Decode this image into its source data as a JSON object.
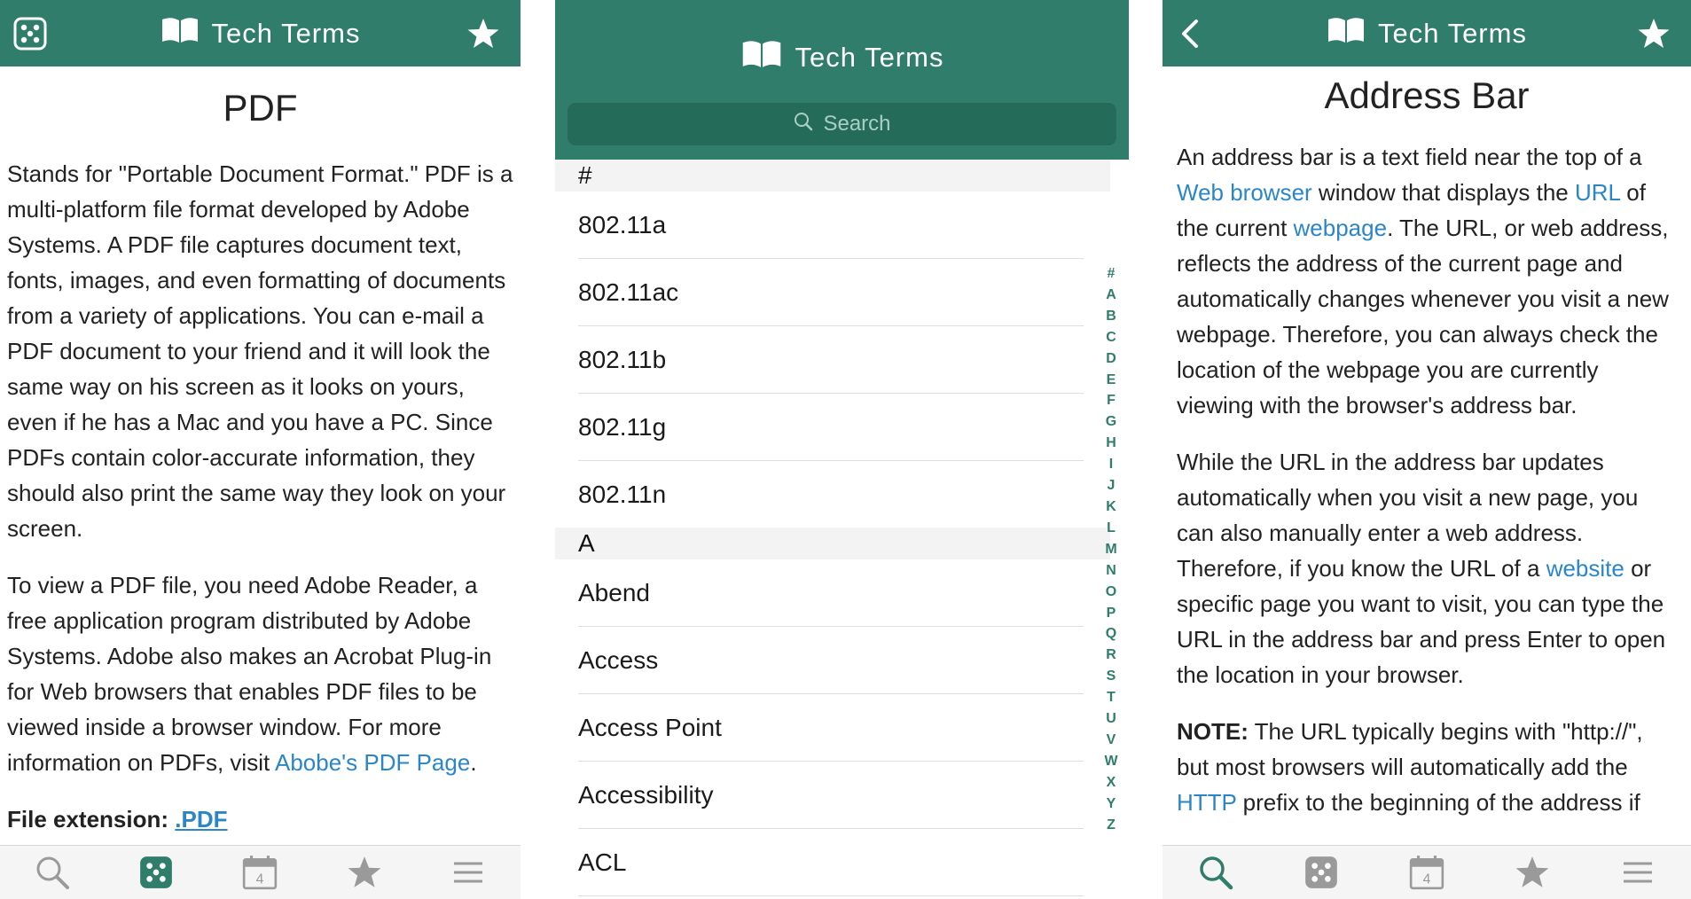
{
  "app_title": "Tech Terms",
  "left": {
    "title": "PDF",
    "paragraph1": "Stands for \"Portable Document Format.\" PDF is a multi-platform file format developed by Adobe Systems. A PDF file captures document text, fonts, images, and even formatting of documents from a variety of applications. You can e-mail a PDF document to your friend and it will look the same way on his screen as it looks on yours, even if he has a Mac and you have a PC. Since PDFs contain color-accurate information, they should also print the same way they look on your screen.",
    "paragraph2_text": "To view a PDF file, you need Adobe Reader, a free application program distributed by Adobe Systems. Adobe also makes an Acrobat Plug-in for Web browsers that enables PDF files to be viewed inside a browser window. For more information on PDFs, visit ",
    "paragraph2_link": "Abobe's PDF Page",
    "paragraph2_end": ".",
    "file_ext_label": "File extension:",
    "file_ext_value": ".PDF"
  },
  "middle": {
    "search_placeholder": "Search",
    "sections": [
      {
        "header": "#",
        "items": [
          "802.11a",
          "802.11ac",
          "802.11b",
          "802.11g",
          "802.11n"
        ]
      },
      {
        "header": "A",
        "items": [
          "Abend",
          "Access",
          "Access Point",
          "Accessibility",
          "ACL"
        ]
      }
    ],
    "index": [
      "#",
      "A",
      "B",
      "C",
      "D",
      "E",
      "F",
      "G",
      "H",
      "I",
      "J",
      "K",
      "L",
      "M",
      "N",
      "O",
      "P",
      "Q",
      "R",
      "S",
      "T",
      "U",
      "V",
      "W",
      "X",
      "Y",
      "Z"
    ]
  },
  "right": {
    "title": "Address Bar",
    "p1_a": "An address bar is a text field near the top of a ",
    "p1_link1": "Web browser",
    "p1_b": " window that displays the ",
    "p1_link2": "URL",
    "p1_c": " of the current ",
    "p1_link3": "webpage",
    "p1_d": ". The URL, or web address, reflects the address of the current page and automatically changes whenever you visit a new webpage. Therefore, you can always check the location of the webpage you are currently viewing with the browser's address bar.",
    "p2_a": "While the URL in the address bar updates automatically when you visit a new page, you can also manually enter a web address. Therefore, if you know the URL of a ",
    "p2_link": "website",
    "p2_b": " or specific page you want to visit, you can type the URL in the address bar and press Enter to open the location in your browser.",
    "p3_label": "NOTE:",
    "p3_a": " The URL typically begins with \"http://\", but most browsers will automatically add the ",
    "p3_link": "HTTP",
    "p3_b": " prefix to the beginning of the address if"
  },
  "tabbar": {
    "calendar_day": "4",
    "tabs": [
      "search-icon",
      "random-dice-icon",
      "calendar-icon",
      "favorites-star-icon",
      "menu-icon"
    ]
  },
  "colors": {
    "brand": "#2f7d6a",
    "link": "#2a86c8",
    "active_tab": "#2f7d6a",
    "inactive_tab": "#9a9a9a"
  }
}
